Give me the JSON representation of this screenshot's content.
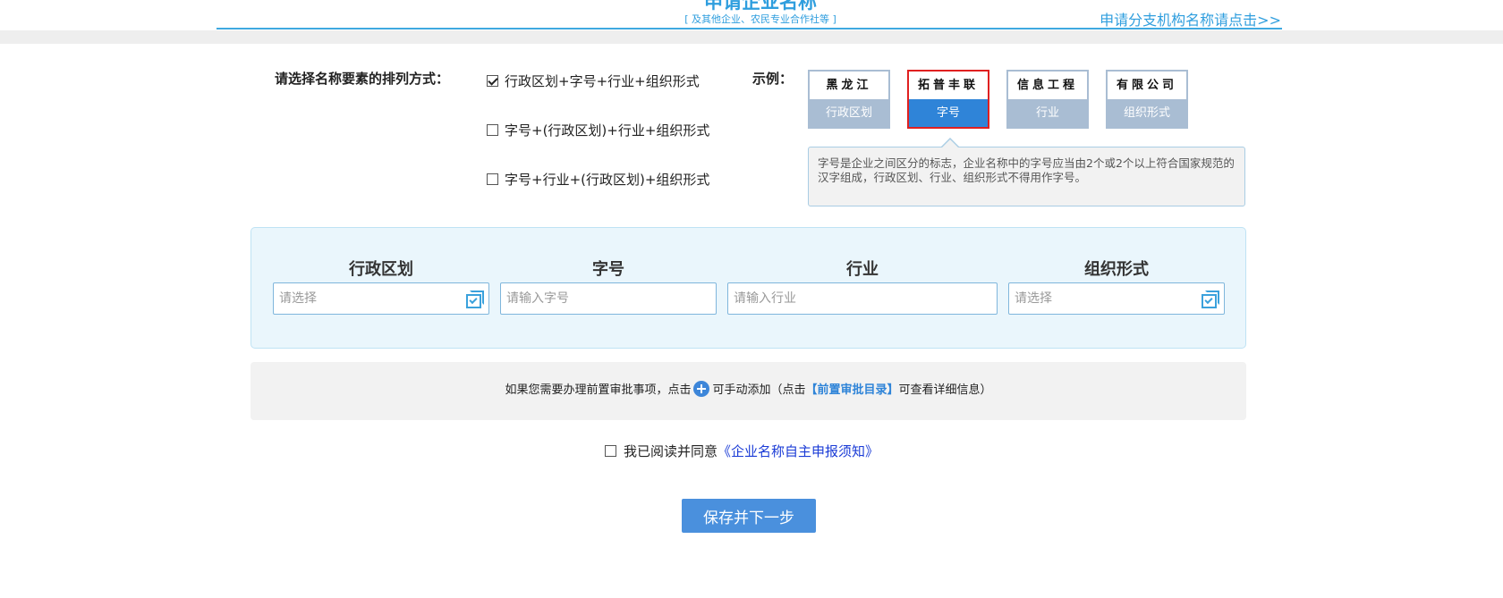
{
  "header": {
    "title": "申请企业名称",
    "subtitle": "[ 及其他企业、农民专业合作社等 ]",
    "branch_link": "申请分支机构名称请点击>>"
  },
  "arrangement": {
    "label": "请选择名称要素的排列方式：",
    "options": [
      {
        "label": "行政区划+字号+行业+组织形式",
        "checked": true
      },
      {
        "label": "字号+(行政区划)+行业+组织形式",
        "checked": false
      },
      {
        "label": "字号+行业+(行政区划)+组织形式",
        "checked": false
      }
    ]
  },
  "example": {
    "label": "示例：",
    "cards": [
      {
        "sample": "黑龙江",
        "label": "行政区划",
        "active": false
      },
      {
        "sample": "拓普丰联",
        "label": "字号",
        "active": true
      },
      {
        "sample": "信息工程",
        "label": "行业",
        "active": false
      },
      {
        "sample": "有限公司",
        "label": "组织形式",
        "active": false
      }
    ],
    "tooltip": "字号是企业之间区分的标志，企业名称中的字号应当由2个或2个以上符合国家规范的汉字组成，行政区划、行业、组织形式不得用作字号。"
  },
  "fields": [
    {
      "title": "行政区划",
      "placeholder": "请选择",
      "value": "",
      "has_select_icon": true,
      "icon": "select-list-icon"
    },
    {
      "title": "字号",
      "placeholder": "请输入字号",
      "value": "",
      "has_select_icon": false
    },
    {
      "title": "行业",
      "placeholder": "请输入行业",
      "value": "",
      "has_select_icon": false
    },
    {
      "title": "组织形式",
      "placeholder": "请选择",
      "value": "",
      "has_select_icon": true,
      "icon": "select-list-icon"
    }
  ],
  "notice": {
    "before": "如果您需要办理前置审批事项，点击",
    "icon": "plus-circle-icon",
    "middle": "可手动添加（点击",
    "link": "【前置审批目录】",
    "after": "可查看详细信息）"
  },
  "agreement": {
    "checked": false,
    "text": "我已阅读并同意",
    "link": "《企业名称自主申报须知》"
  },
  "submit": {
    "label": "保存并下一步"
  },
  "colors": {
    "accent": "#2f9ede",
    "button": "#4a90dd",
    "active_card": "#2f84d8",
    "active_border": "#e02020",
    "panel_bg": "#eaf6fc"
  }
}
